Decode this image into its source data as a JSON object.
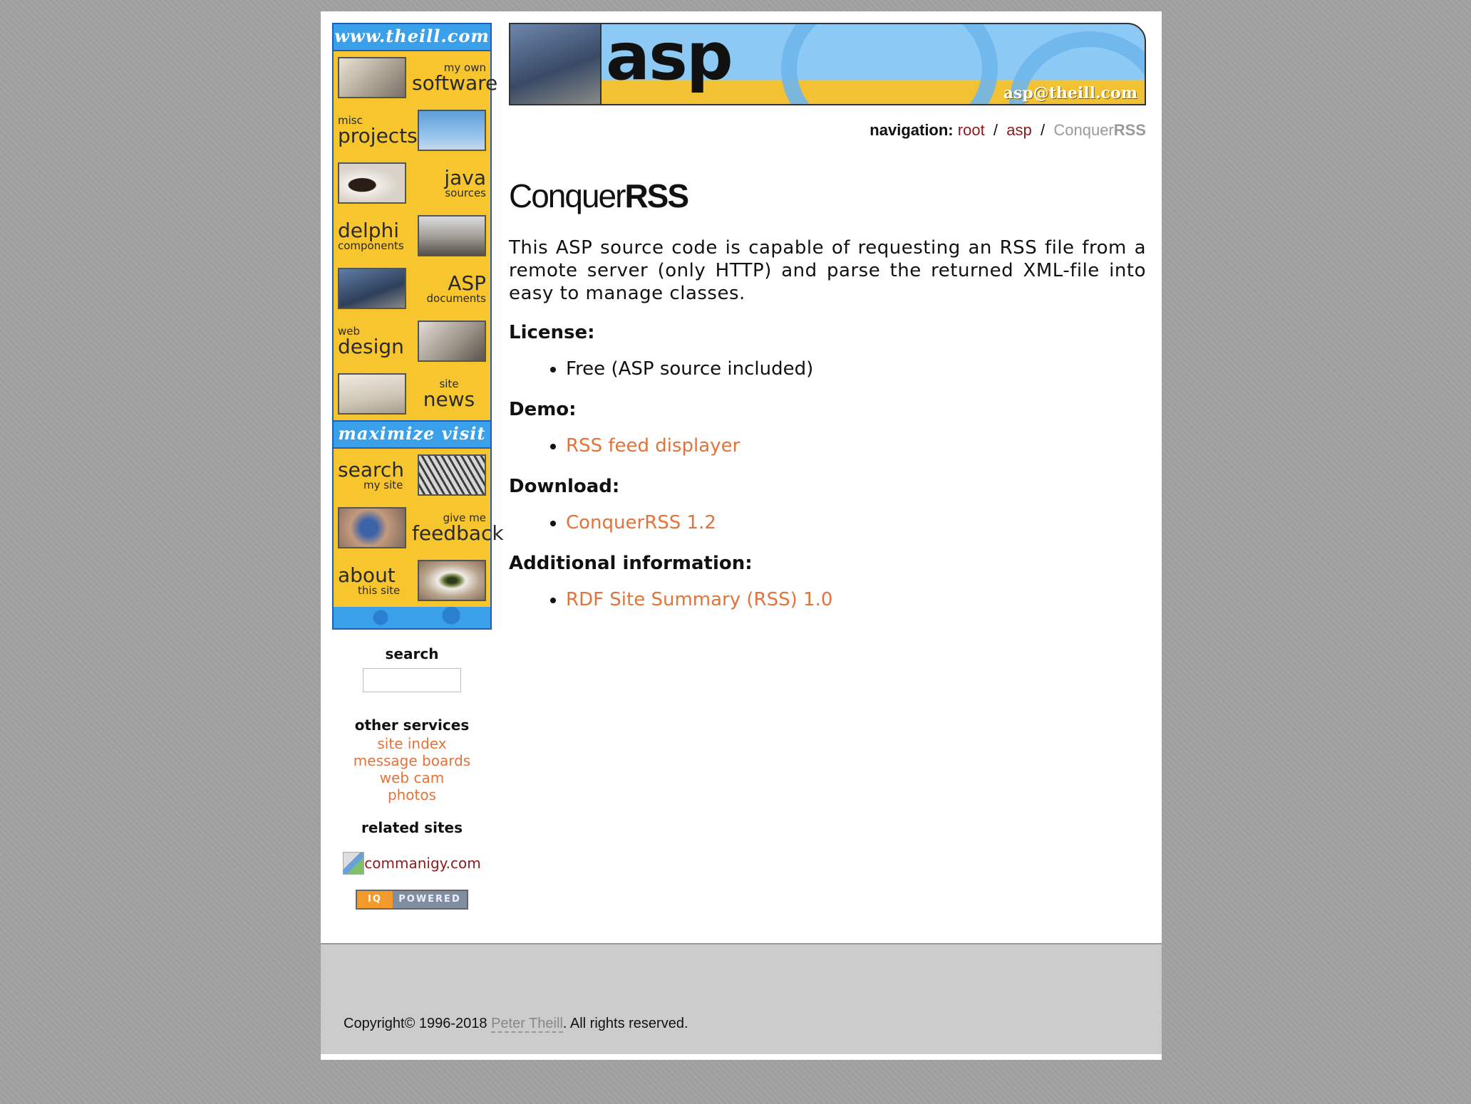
{
  "sidebar": {
    "header": "www.theill.com",
    "maximize_header": "maximize visit",
    "nav_items": [
      {
        "small": "my own",
        "big": "software",
        "icon": "software-photo-icon"
      },
      {
        "small": "misc",
        "big": "projects",
        "icon": "windmill-photo-icon"
      },
      {
        "small": "java",
        "big": "sources",
        "icon": "coffee-cup-photo-icon"
      },
      {
        "small": "delphi",
        "big": "components",
        "icon": "ruins-photo-icon"
      },
      {
        "small": "ASP",
        "big": "documents",
        "icon": "fountain-pen-photo-icon"
      },
      {
        "small": "web",
        "big": "design",
        "icon": "face-photo-icon"
      },
      {
        "small": "site",
        "big": "news",
        "icon": "newspaper-photo-icon"
      }
    ],
    "maximize_items": [
      {
        "small": "my site",
        "big": "search",
        "icon": "bridge-photo-icon"
      },
      {
        "small": "give me",
        "big": "feedback",
        "icon": "phone-photo-icon"
      },
      {
        "small": "this site",
        "big": "about",
        "icon": "eye-photo-icon"
      }
    ],
    "search": {
      "title": "search",
      "placeholder": ""
    },
    "other_services": {
      "title": "other services",
      "links": [
        "site index",
        "message boards",
        "web cam",
        "photos"
      ]
    },
    "related_sites": {
      "title": "related sites",
      "image_alt": "commanigy.com",
      "badge_left": "IQ",
      "badge_right": "POWERED"
    }
  },
  "banner": {
    "title": "asp",
    "email": "asp@theill.com"
  },
  "breadcrumb": {
    "label": "navigation:",
    "items": [
      "root",
      "asp"
    ],
    "current_light": "Conquer",
    "current_bold": "RSS"
  },
  "main": {
    "title_light": "Conquer",
    "title_bold": "RSS",
    "intro": "This ASP source code is capable of requesting an RSS file from a remote server (only HTTP) and parse the returned XML-file into easy to manage classes.",
    "sections": [
      {
        "heading": "License:",
        "items": [
          {
            "text": "Free (ASP source included)",
            "link": false
          }
        ]
      },
      {
        "heading": "Demo:",
        "items": [
          {
            "text": "RSS feed displayer",
            "link": true
          }
        ]
      },
      {
        "heading": "Download:",
        "items": [
          {
            "text": "ConquerRSS 1.2",
            "link": true
          }
        ]
      },
      {
        "heading": "Additional information:",
        "items": [
          {
            "text": "RDF Site Summary (RSS) 1.0",
            "link": true
          }
        ]
      }
    ]
  },
  "footer": {
    "copyright_prefix": "Copyright© 1996-2018 ",
    "author": "Peter Theill",
    "copyright_suffix": ". All rights reserved."
  },
  "colors": {
    "link": "#e2733a",
    "breadcrumb_link": "#8b1a1a",
    "nav_yellow": "#f7c62f",
    "nav_blue": "#3aa0ea"
  }
}
